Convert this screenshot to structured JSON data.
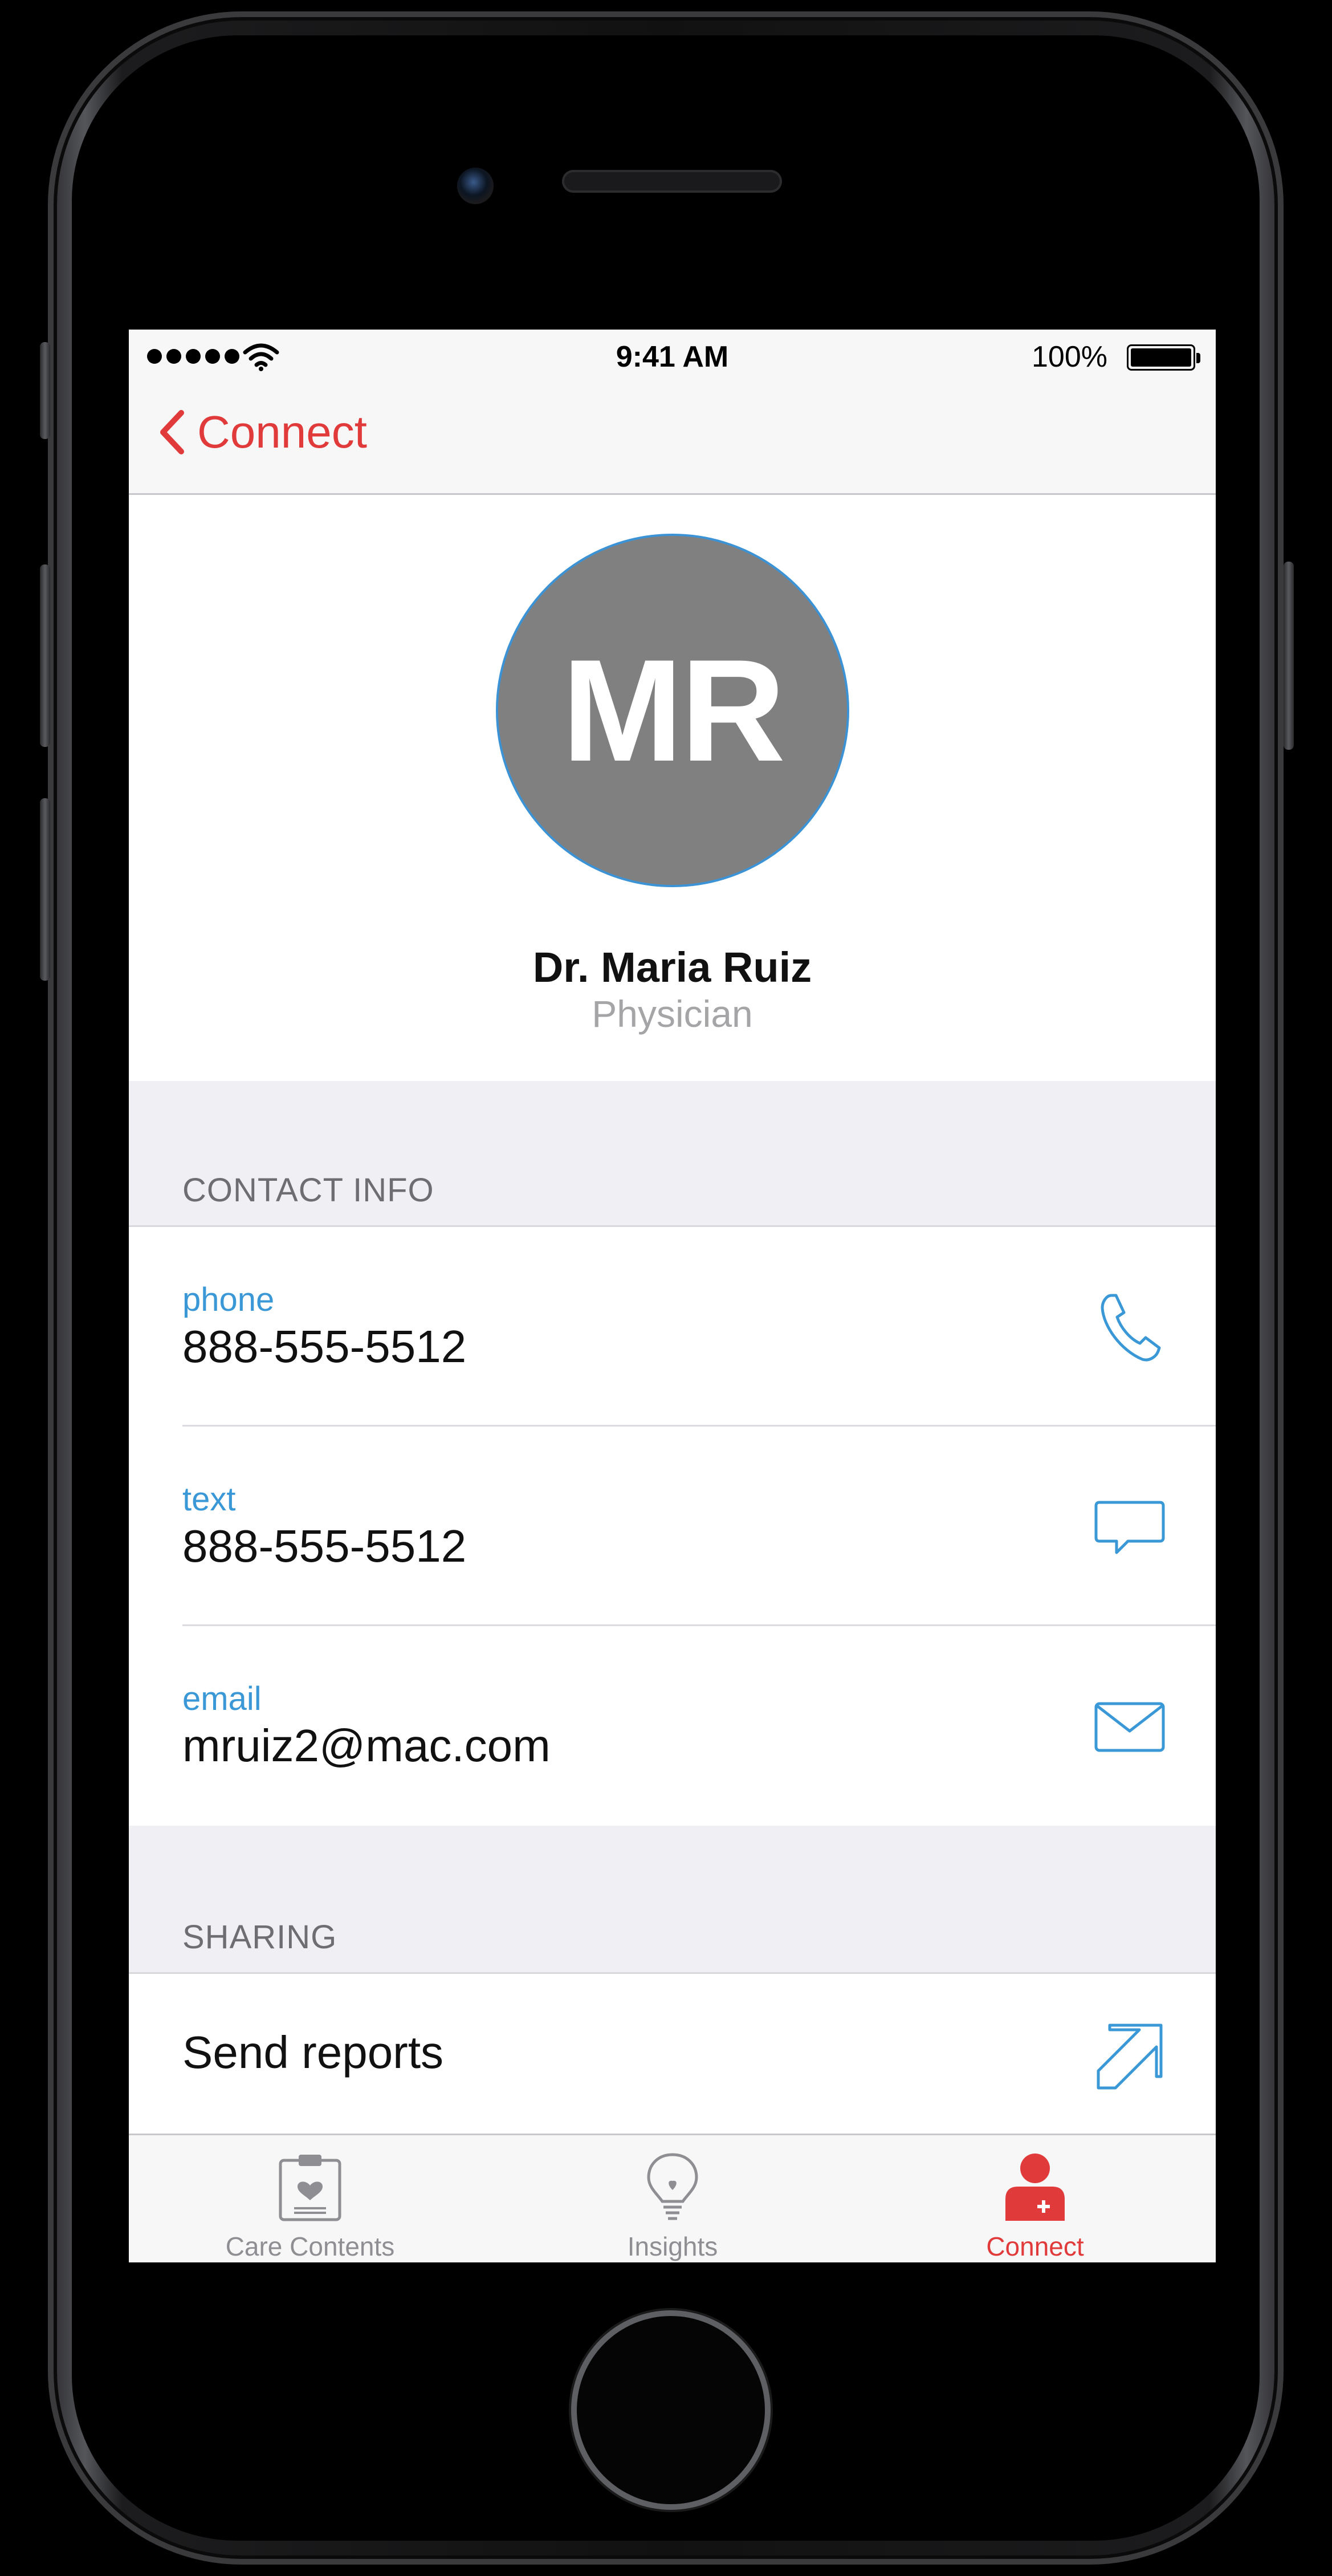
{
  "status_bar": {
    "time": "9:41 AM",
    "battery_percent": "100%",
    "signal_bars": 5,
    "wifi_icon": "wifi-icon",
    "battery_icon": "battery-full-icon"
  },
  "nav": {
    "back_label": "Connect",
    "back_icon": "chevron-left-icon"
  },
  "profile": {
    "initials": "MR",
    "name": "Dr. Maria Ruiz",
    "role": "Physician"
  },
  "contact": {
    "header": "CONTACT INFO",
    "items": [
      {
        "label": "phone",
        "value": "888-555-5512",
        "icon": "phone-icon"
      },
      {
        "label": "text",
        "value": "888-555-5512",
        "icon": "message-bubble-icon"
      },
      {
        "label": "email",
        "value": "mruiz2@mac.com",
        "icon": "envelope-icon"
      }
    ]
  },
  "sharing": {
    "header": "SHARING",
    "send_label": "Send reports",
    "send_icon": "arrow-up-right-icon"
  },
  "tabs": [
    {
      "label": "Care Contents",
      "icon": "clipboard-heart-icon",
      "active": false
    },
    {
      "label": "Insights",
      "icon": "lightbulb-icon",
      "active": false
    },
    {
      "label": "Connect",
      "icon": "person-connect-icon",
      "active": true
    }
  ],
  "colors": {
    "accent_red": "#e13a3a",
    "accent_blue": "#3b98d7",
    "avatar_gray": "#808080",
    "tab_inactive": "#8e8e93"
  }
}
